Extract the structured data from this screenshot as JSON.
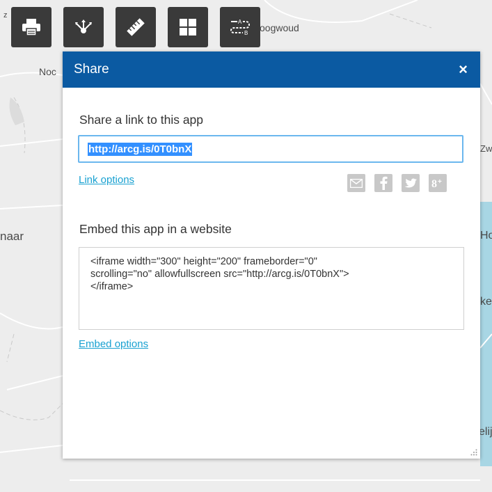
{
  "map": {
    "labels": {
      "hoogwoud": "oogwoud",
      "noo": "Noc",
      "naar": "naar",
      "zw": "Zw",
      "ho": "Ho",
      "ke": "ke",
      "elij": "elij",
      "z": "z"
    }
  },
  "toolbar": {
    "buttons": [
      "print",
      "share",
      "measure",
      "basemap-gallery",
      "directions"
    ]
  },
  "dialog": {
    "title": "Share",
    "close_label": "×",
    "share_label": "Share a link to this app",
    "url_value": "http://arcg.is/0T0bnX",
    "link_options": "Link options",
    "social": [
      "email-icon",
      "facebook-icon",
      "twitter-icon",
      "google-plus-icon"
    ],
    "embed_label": "Embed this app in a website",
    "embed_code": "<iframe width=\"300\" height=\"200\" frameborder=\"0\"\nscrolling=\"no\" allowfullscreen src=\"http://arcg.is/0T0bnX\">\n</iframe>",
    "embed_options": "Embed options"
  }
}
